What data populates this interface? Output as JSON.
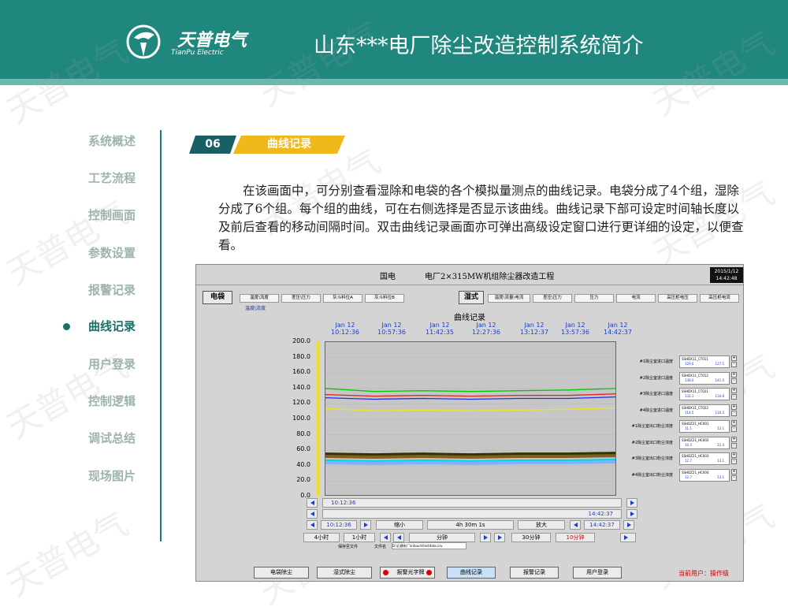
{
  "header": {
    "brand": "天普电气",
    "brand_sub": "TianPu Electric",
    "title": "山东***电厂除尘改造控制系统简介",
    "watermark": "天普电气"
  },
  "nav": {
    "items": [
      {
        "label": "系统概述"
      },
      {
        "label": "工艺流程"
      },
      {
        "label": "控制画面"
      },
      {
        "label": "参数设置"
      },
      {
        "label": "报警记录"
      },
      {
        "label": "曲线记录",
        "active": true
      },
      {
        "label": "用户登录"
      },
      {
        "label": "控制逻辑"
      },
      {
        "label": "调试总结"
      },
      {
        "label": "现场图片"
      }
    ]
  },
  "section": {
    "number": "06",
    "name": "曲线记录",
    "paragraph": "在该画面中，可分别查看湿除和电袋的各个模拟量测点的曲线记录。电袋分成了4个组，湿除分成了6个组。每个组的曲线，可在右侧选择是否显示该曲线。曲线记录下部可设定时间轴长度以及前后查看的移动间隔时间。双击曲线记录画面亦可弹出高级设定窗口进行更详细的设定，以便查看。"
  },
  "screenshot": {
    "company": "国电",
    "project": "电厂2×315MW机组除尘器改造工程",
    "clock_date": "2015/1/12",
    "clock_time": "14:42:48",
    "bag_button": "电袋",
    "bag_tabs": [
      "温度\\流度",
      "差压\\压力",
      "灰斗料位A",
      "灰斗料位B"
    ],
    "bag_sub": "温度\\流度",
    "wet_button": "湿式",
    "wet_tabs": [
      "温度\\流量\\电流",
      "差压\\压力",
      "压力",
      "电流",
      "高压柜电压",
      "高压柜电流"
    ],
    "chart_title": "曲线记录",
    "right_labels": [
      "#1除尘室进口温度",
      "#2除尘室进口温度",
      "#3除尘室进口温度",
      "#4除尘室进口温度",
      "#1除尘室出口粉尘浓度",
      "#2除尘室出口粉尘浓度",
      "#3除尘室出口粉尘浓度",
      "#4除尘室出口粉尘浓度"
    ],
    "right_tags": [
      "SSHDX11_CT011",
      "SSHDX11_CT012",
      "SSHDX11_CT021",
      "SSHDX11_CT022",
      "SSHDZ21_HC001",
      "SSHDZ21_HC002",
      "SSHDZ21_HC003",
      "SSHDZ21_HC004"
    ],
    "right_values": [
      [
        "129.0",
        "127.5"
      ],
      [
        "138.0",
        "141.0"
      ],
      [
        "132.1",
        "134.8"
      ],
      [
        "114.5",
        "116.5"
      ],
      [
        "11.1",
        "12.1"
      ],
      [
        "10.3",
        "12.4"
      ],
      [
        "12.7",
        "13.1"
      ],
      [
        "12.7",
        "13.1"
      ]
    ],
    "scroll_start": "10:12:36",
    "scroll_end": "14:42:37",
    "ctrl": {
      "start": "10:12:36",
      "zoom_out": "缩小",
      "span": "4h 30m 1s",
      "zoom_in": "放大",
      "end": "14:42:37",
      "hour4": "4小时",
      "hour1": "1小时",
      "minutes": "分钟",
      "min30": "30分钟",
      "min10": "10分钟",
      "save_dir_label": "保存至文件",
      "file_label": "文件名",
      "file_path": "D:\\石横电厂\\intouch\\histdata.csv"
    },
    "nav_buttons": [
      "电袋除尘",
      "湿式除尘",
      "报警光字牌",
      "曲线记录",
      "报警记录",
      "用户登录"
    ],
    "current_user": "当前用户：操作级"
  },
  "chart_data": {
    "type": "line",
    "title": "曲线记录",
    "x": [
      "Jan 12 10:12:36",
      "Jan 12 10:57:36",
      "Jan 12 11:42:35",
      "Jan 12 12:27:36",
      "Jan 12 13:12:37",
      "Jan 12 13:57:36",
      "Jan 12 14:42:37"
    ],
    "ylim": [
      0,
      200
    ],
    "yticks": [
      "200.0",
      "180.0",
      "160.0",
      "140.0",
      "120.0",
      "100.0",
      "80.0",
      "60.0",
      "40.0",
      "20.0",
      "0.0"
    ],
    "series": [
      {
        "color": "#00c800",
        "values": [
          140,
          136,
          137,
          136,
          137,
          138,
          140
        ]
      },
      {
        "color": "#e02020",
        "values": [
          132,
          130,
          131,
          130,
          131,
          131,
          133
        ]
      },
      {
        "color": "#2030e0",
        "values": [
          128,
          126,
          127,
          126,
          127,
          127,
          129
        ]
      },
      {
        "color": "#e8e820",
        "values": [
          114,
          111,
          112,
          111,
          112,
          113,
          115
        ]
      },
      {
        "color": "#333300",
        "values": [
          55,
          54,
          55,
          54,
          55,
          55,
          56
        ]
      },
      {
        "color": "#806020",
        "values": [
          52,
          51,
          52,
          51,
          52,
          52,
          53
        ]
      },
      {
        "color": "#00d8e0",
        "values": [
          46,
          45,
          46,
          45,
          46,
          46,
          47
        ]
      },
      {
        "color": "#80b0ff",
        "values": [
          44,
          43,
          44,
          43,
          44,
          44,
          45
        ]
      }
    ]
  }
}
